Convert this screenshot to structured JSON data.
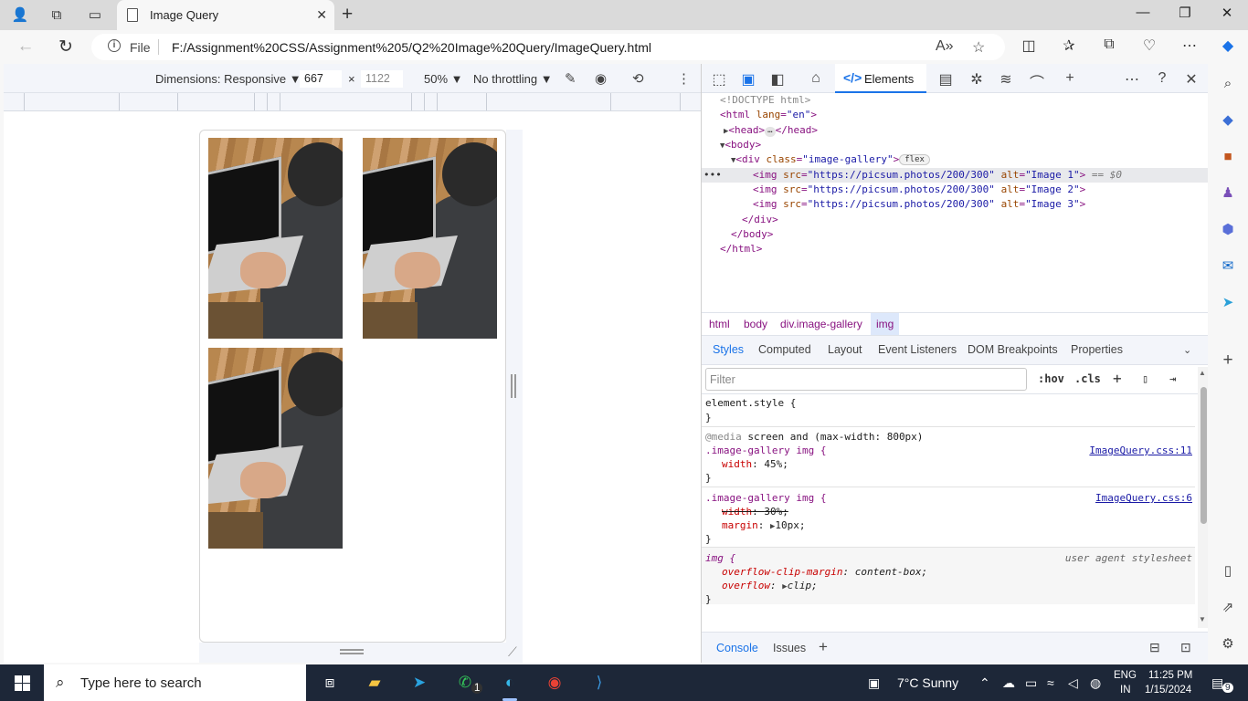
{
  "browser": {
    "tab_title": "Image Query",
    "address": {
      "scheme_label": "File",
      "url": "F:/Assignment%20CSS/Assignment%205/Q2%20Image%20Query/ImageQuery.html"
    }
  },
  "device_toolbar": {
    "dimensions_label": "Dimensions: Responsive",
    "width": "667",
    "height_placeholder": "1122",
    "times": "×",
    "zoom": "50%",
    "throttling": "No throttling"
  },
  "page": {
    "images": [
      {
        "alt": "Image 1"
      },
      {
        "alt": "Image 2"
      },
      {
        "alt": "Image 3"
      }
    ]
  },
  "devtools": {
    "active_tab": "Elements",
    "dom": {
      "doctype": "<!DOCTYPE html>",
      "html_open_tag": "html",
      "html_attr": "lang",
      "html_attr_val": "\"en\"",
      "head_tag": "head",
      "head_close": "/head",
      "body_tag": "body",
      "div_tag": "div",
      "div_attr": "class",
      "div_attr_val": "\"image-gallery\"",
      "flex_badge": "flex",
      "img_tag": "img",
      "img_src_attr": "src",
      "img_src_val": "\"https://picsum.photos/200/300\"",
      "img_alt_attr": "alt",
      "img_alts": [
        "\"Image 1\"",
        "\"Image 2\"",
        "\"Image 3\""
      ],
      "selected_marker": "== $0",
      "div_close": "/div",
      "body_close": "/body",
      "html_close": "/html",
      "row_dots": "•••"
    },
    "breadcrumbs": [
      "html",
      "body",
      "div.image-gallery",
      "img"
    ],
    "subtabs": [
      "Styles",
      "Computed",
      "Layout",
      "Event Listeners",
      "DOM Breakpoints",
      "Properties"
    ],
    "filter_placeholder": "Filter",
    "hov_label": ":hov",
    "cls_label": ".cls",
    "styles": {
      "element_style": "element.style {",
      "close_brace": "}",
      "media_at": "@media",
      "media_query": "screen and (max-width: 800px)",
      "rule1_selector": ".image-gallery img {",
      "rule1_source": "ImageQuery.css:11",
      "rule1_prop": "width",
      "rule1_val": "45%;",
      "rule2_selector": ".image-gallery img {",
      "rule2_source": "ImageQuery.css:6",
      "rule2_prop1": "width",
      "rule2_val1": "30%;",
      "rule2_prop2": "margin",
      "rule2_val2": "10px;",
      "ua_selector": "img {",
      "ua_source": "user agent stylesheet",
      "ua_prop1": "overflow-clip-margin",
      "ua_val1": "content-box;",
      "ua_prop2": "overflow",
      "ua_val2": "clip;"
    },
    "drawer_tabs": [
      "Console",
      "Issues"
    ]
  },
  "taskbar": {
    "search_placeholder": "Type here to search",
    "weather": "7°C  Sunny",
    "lang_top": "ENG",
    "lang_bottom": "IN",
    "time": "11:25 PM",
    "date": "1/15/2024",
    "notif_count": "9",
    "whatsapp_badge": "1"
  },
  "colors": {
    "accent": "#1a73e8",
    "taskbar": "#1d2738",
    "tag": "#881280",
    "attr": "#994500",
    "attr_value": "#1a1aa6"
  }
}
